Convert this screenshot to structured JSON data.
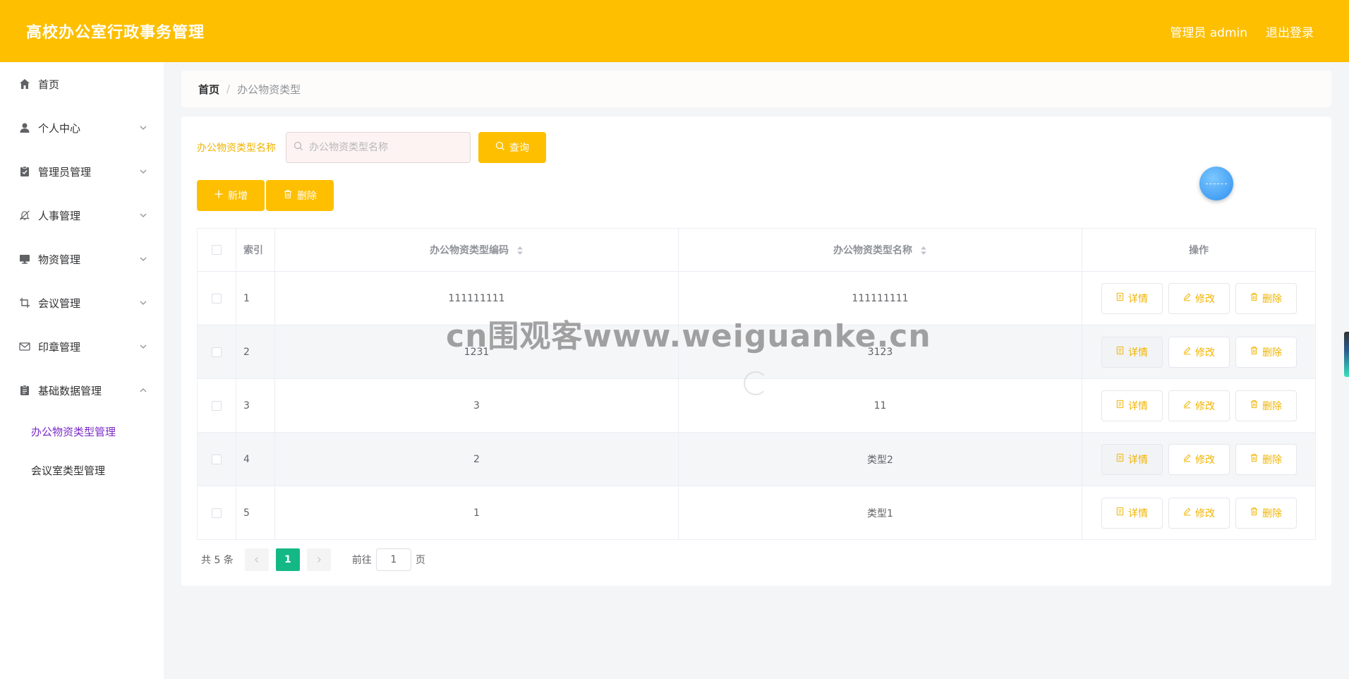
{
  "header": {
    "title": "高校办公室行政事务管理",
    "user": "管理员 admin",
    "logout": "退出登录"
  },
  "sidebar": {
    "items": [
      {
        "label": "首页",
        "icon": "home-icon"
      },
      {
        "label": "个人中心",
        "icon": "user-icon"
      },
      {
        "label": "管理员管理",
        "icon": "clipboard-check-icon"
      },
      {
        "label": "人事管理",
        "icon": "bell-off-icon"
      },
      {
        "label": "物资管理",
        "icon": "monitor-icon"
      },
      {
        "label": "会议管理",
        "icon": "crop-icon"
      },
      {
        "label": "印章管理",
        "icon": "mail-icon"
      },
      {
        "label": "基础数据管理",
        "icon": "document-icon"
      }
    ],
    "subitems": [
      {
        "label": "办公物资类型管理",
        "active": true
      },
      {
        "label": "会议室类型管理",
        "active": false
      }
    ],
    "active_color": "#7a2bc7"
  },
  "breadcrumb": {
    "home": "首页",
    "separator": "/",
    "current": "办公物资类型"
  },
  "search": {
    "label": "办公物资类型名称",
    "placeholder": "办公物资类型名称",
    "button": "查询"
  },
  "actions": {
    "add": "新增",
    "delete": "删除"
  },
  "table": {
    "headers": {
      "index": "索引",
      "code": "办公物资类型编码",
      "name": "办公物资类型名称",
      "op": "操作"
    },
    "rows": [
      {
        "index": "1",
        "code": "111111111",
        "name": "111111111"
      },
      {
        "index": "2",
        "code": "1231",
        "name": "3123"
      },
      {
        "index": "3",
        "code": "3",
        "name": "11"
      },
      {
        "index": "4",
        "code": "2",
        "name": "类型2"
      },
      {
        "index": "5",
        "code": "1",
        "name": "类型1"
      }
    ],
    "op_labels": {
      "detail": "详情",
      "edit": "修改",
      "delete": "删除"
    }
  },
  "pagination": {
    "total": "共 5 条",
    "current_page": "1",
    "goto_label": "前往",
    "goto_value": "1",
    "unit": "页"
  },
  "watermark": "cn围观客www.weiguanke.cn",
  "colors": {
    "brand": "#fdbf00",
    "pagination_active": "#14b885"
  }
}
